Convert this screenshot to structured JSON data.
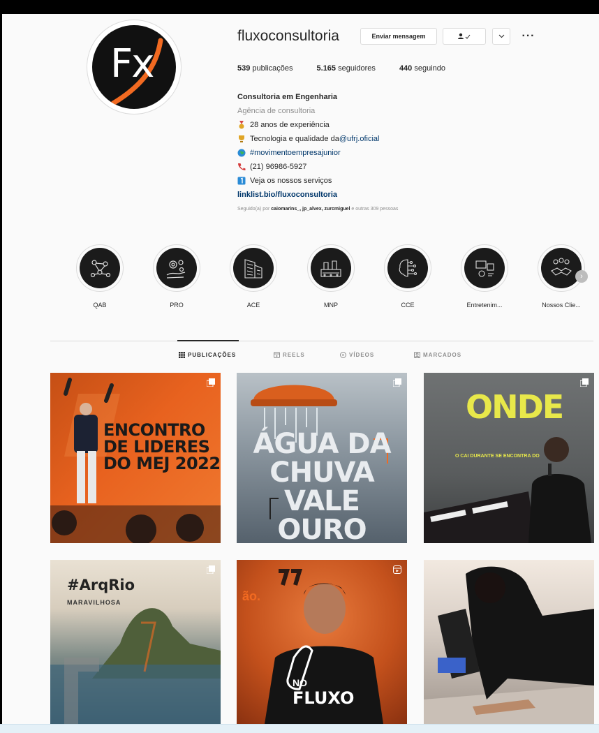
{
  "profile": {
    "username": "fluxoconsultoria",
    "avatar_text": "Fx",
    "message_button": "Enviar mensagem",
    "follow_icon": "person-check-icon",
    "suggest_icon": "chevron-down-icon",
    "more_icon": "more-horizontal-icon",
    "more_glyph": "···"
  },
  "stats": {
    "posts_num": "539",
    "posts_label": "publicações",
    "followers_num": "5.165",
    "followers_label": "seguidores",
    "following_num": "440",
    "following_label": "seguindo"
  },
  "bio": {
    "name": "Consultoria em Engenharia",
    "category": "Agência de consultoria",
    "line1": "28 anos de experiência",
    "line2_text": "Tecnologia e qualidade da ",
    "line2_tag": "@ufrj.oficial",
    "line3_tag": "#movimentoempresajunior",
    "line4": "(21) 96986-5927",
    "line5": "Veja os nossos serviços",
    "link": "linklist.bio/fluxoconsultoria",
    "followed_prefix": "Seguido(a) por ",
    "followed_names": "caiomarins_, jp_alvex, zurcmiguel",
    "followed_suffix": " e outras 309 pessoas"
  },
  "highlights": [
    {
      "label": "QAB",
      "icon": "molecule-icon"
    },
    {
      "label": "PRO",
      "icon": "gears-hand-icon"
    },
    {
      "label": "ACE",
      "icon": "building-icon"
    },
    {
      "label": "MNP",
      "icon": "factory-icon"
    },
    {
      "label": "CCE",
      "icon": "brain-icon"
    },
    {
      "label": "Entretenim...",
      "icon": "media-icon"
    },
    {
      "label": "Nossos Clie...",
      "icon": "handshake-icon"
    }
  ],
  "tabs": [
    {
      "label": "PUBLICAÇÕES",
      "icon": "grid-icon"
    },
    {
      "label": "REELS",
      "icon": "reels-icon"
    },
    {
      "label": "VÍDEOS",
      "icon": "play-icon"
    },
    {
      "label": "MARCADOS",
      "icon": "tagged-icon"
    }
  ],
  "posts": [
    {
      "text": "ENCONTRO\nDE LIDERES\nDO MEJ 2022",
      "badge": "carousel-icon"
    },
    {
      "text": "ÁGUA DA\nCHUVA\nVALE\nOURO",
      "badge": "carousel-icon"
    },
    {
      "text": "ONDE",
      "subtext": "O CAÍ DURANTE SE ENCONTRA DO",
      "badge": "carousel-icon"
    },
    {
      "text": "#ArqRio",
      "subtext": "MARAVILHOSA",
      "badge": "carousel-icon"
    },
    {
      "text": "FLUXO",
      "subtext": "NO",
      "top_text": "ão.",
      "badge": "reel-icon"
    },
    {
      "badge": "none"
    }
  ],
  "colors": {
    "brand_orange": "#f26a21",
    "link_blue": "#00376b",
    "muted": "#8e8e8e",
    "border": "#dbdbdb"
  }
}
